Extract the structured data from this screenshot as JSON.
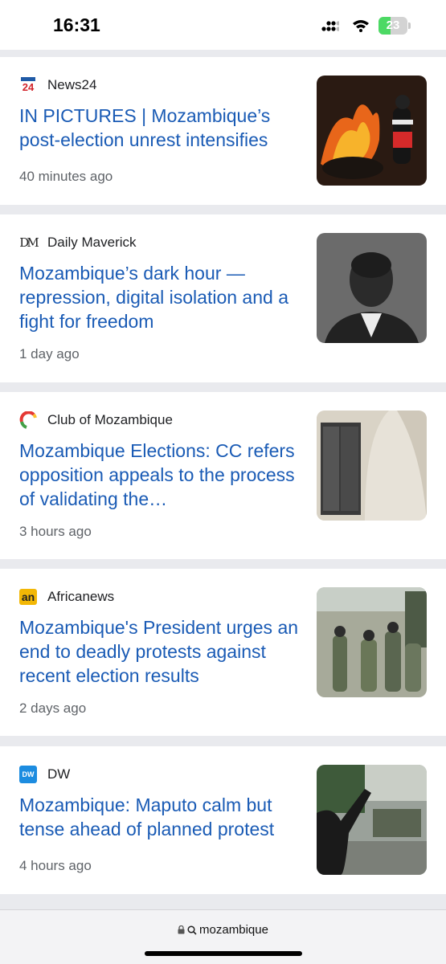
{
  "status_bar": {
    "time": "16:31",
    "battery_level": "23",
    "battery_percent": 23,
    "icons": [
      "signal-icon",
      "wifi-icon",
      "battery-icon"
    ]
  },
  "articles": [
    {
      "source": "News24",
      "logo_text": "24",
      "headline": "IN PICTURES | Mozambique’s post-election unrest intensifies",
      "age": "40 minutes ago"
    },
    {
      "source": "Daily Maverick",
      "logo_text": "DM",
      "headline": "Mozambique’s dark hour — repression, digital isolation and a fight for freedom",
      "age": "1 day ago"
    },
    {
      "source": "Club of Mozambique",
      "headline": "Mozambique Elections: CC refers opposition appeals to the process of validating the…",
      "age": "3 hours ago"
    },
    {
      "source": "Africanews",
      "logo_text": "an",
      "headline": "Mozambique's President urges an end to deadly protests against recent election results",
      "age": "2 days ago"
    },
    {
      "source": "DW",
      "logo_text": "DW",
      "headline": "Mozambique: Maputo calm but tense ahead of planned protest",
      "age": "4 hours ago"
    }
  ],
  "address_bar": {
    "query": "mozambique",
    "icons": [
      "lock-icon",
      "search-icon"
    ]
  },
  "colors": {
    "headline": "#1a5bb5",
    "background": "#e9eaee",
    "battery": "#4cd964"
  }
}
